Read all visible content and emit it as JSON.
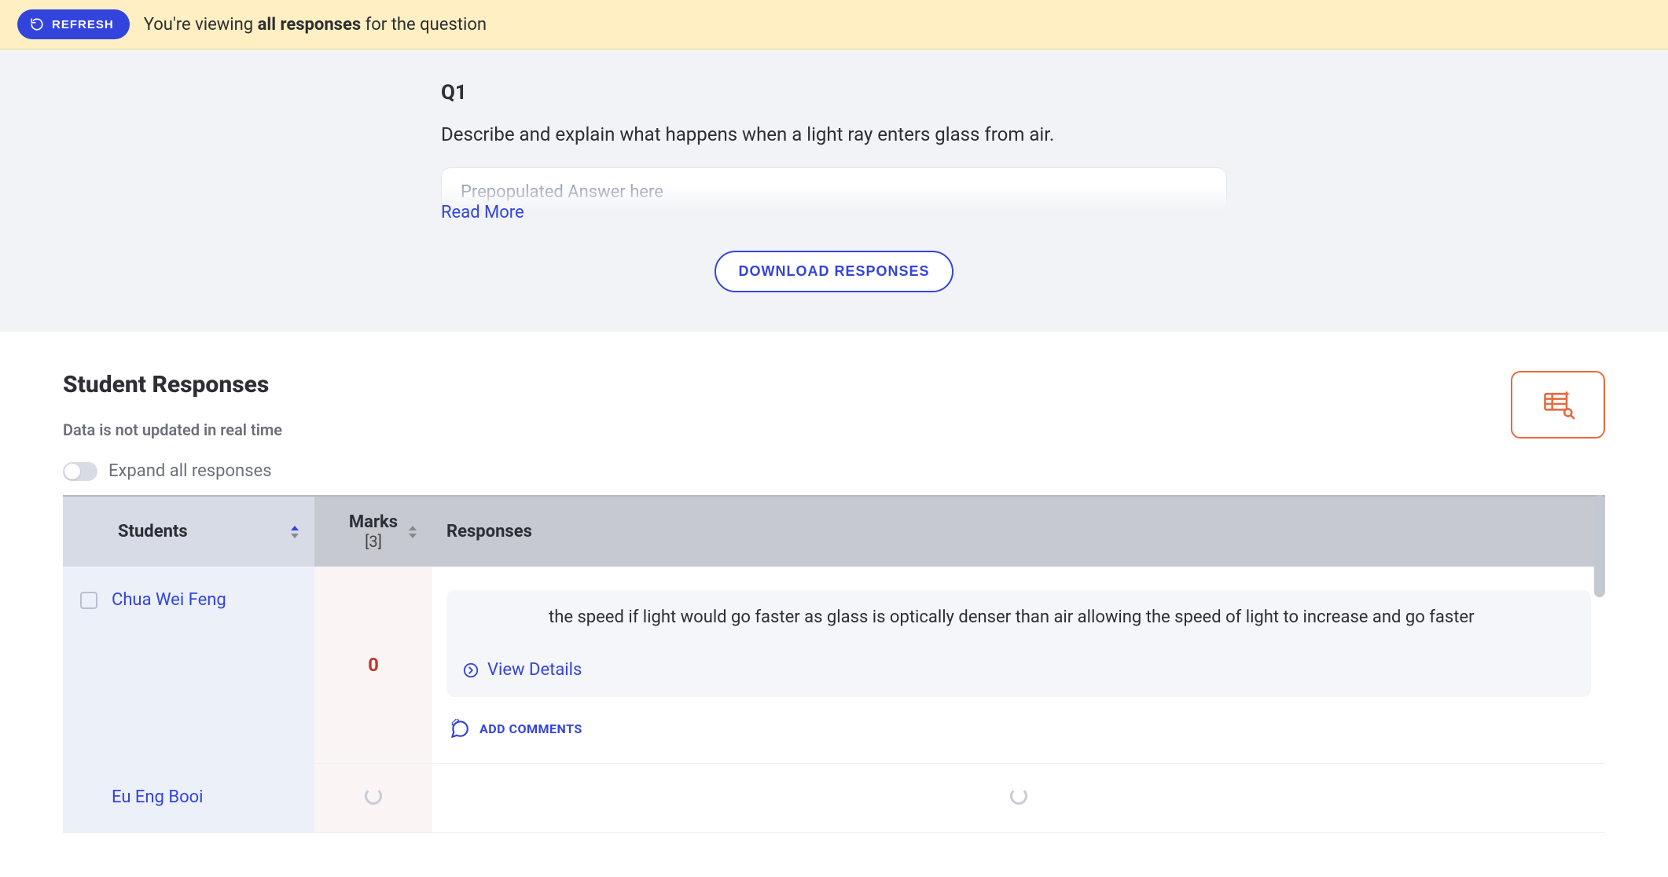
{
  "banner": {
    "refresh_label": "REFRESH",
    "text_pre": "You're viewing ",
    "text_strong": "all responses",
    "text_post": " for the question"
  },
  "question": {
    "number": "Q1",
    "text": "Describe and explain what happens when a light ray enters glass from air.",
    "answer_placeholder": "Prepopulated Answer here",
    "read_more_label": "Read More",
    "download_label": "DOWNLOAD RESPONSES"
  },
  "responses": {
    "title": "Student Responses",
    "note": "Data is not updated in real time",
    "expand_label": "Expand all responses",
    "columns": {
      "students": "Students",
      "marks": "Marks",
      "marks_total": "[3]",
      "responses": "Responses"
    },
    "rows": [
      {
        "student": "Chua Wei Feng",
        "mark": "0",
        "response_text": "the speed if light would go faster as glass is optically denser than air allowing the speed of light to increase and go faster",
        "view_details": "View Details",
        "add_comments": "ADD COMMENTS",
        "loading": false,
        "has_checkbox": true
      },
      {
        "student": "Eu Eng Booi",
        "mark": "",
        "response_text": "",
        "view_details": "",
        "add_comments": "",
        "loading": true,
        "has_checkbox": false
      }
    ]
  }
}
